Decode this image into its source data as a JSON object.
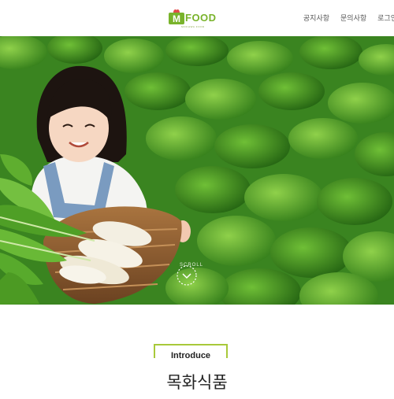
{
  "header": {
    "logo_text": "FOOD",
    "logo_letter": "M",
    "logo_sub": "MOKHWA FOOD",
    "nav": [
      "공지사항",
      "문의사항",
      "로그인"
    ]
  },
  "hero": {
    "scroll_label": "SCROLL"
  },
  "intro": {
    "label": "Introduce",
    "title": "목화식품"
  }
}
